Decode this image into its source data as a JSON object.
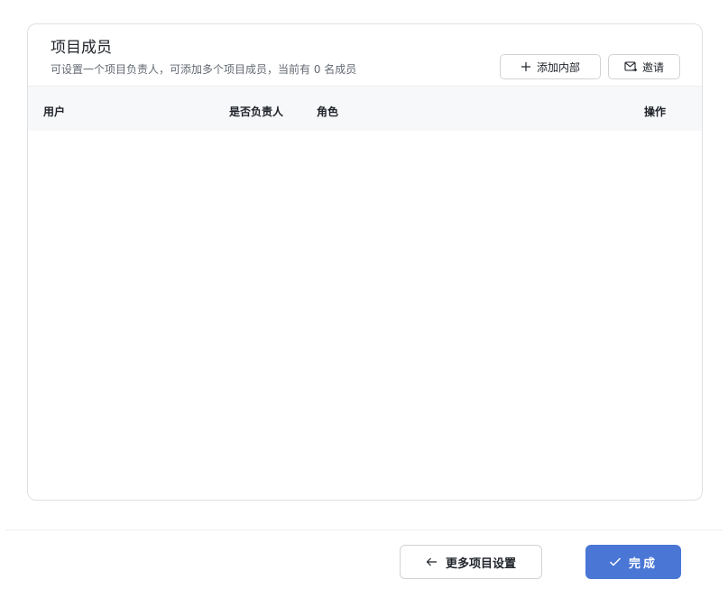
{
  "members": {
    "title": "项目成员",
    "subtitle": "可设置一个项目负责人，可添加多个项目成员，当前有 0 名成员",
    "add_internal_label": "添加内部",
    "invite_label": "邀请",
    "columns": [
      "用户",
      "是否负责人",
      "角色",
      "操作"
    ],
    "rows": []
  },
  "footer": {
    "more_settings_label": "更多项目设置",
    "done_label": "完成"
  },
  "icons": {
    "add": "plus-icon",
    "invite": "mail-icon",
    "more": "arrow-left-icon",
    "done": "check-icon"
  },
  "colors": {
    "primary": "#4a76d6",
    "header_bg": "#f7f8fa",
    "border": "#dee0e3"
  }
}
